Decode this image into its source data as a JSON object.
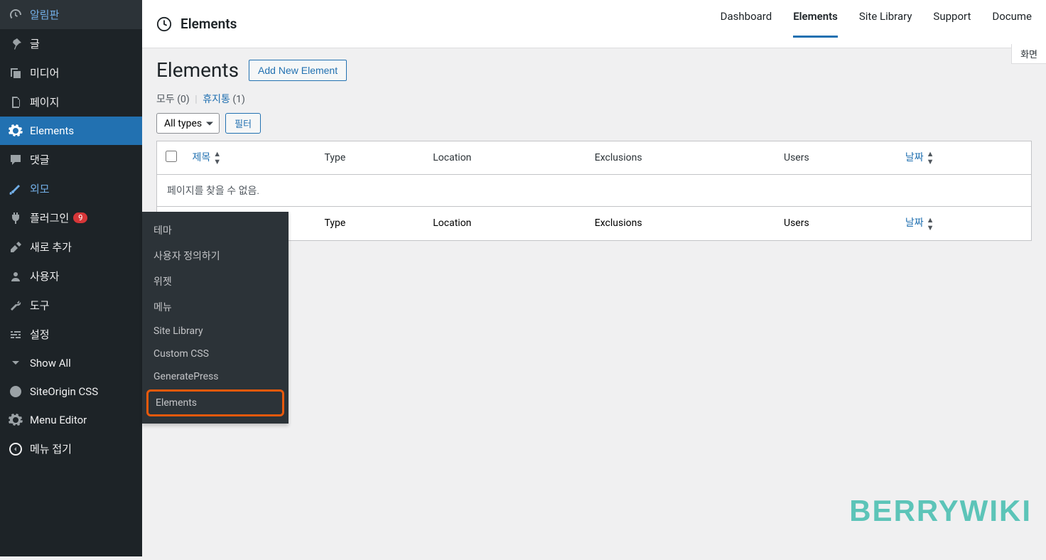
{
  "sidebar": {
    "items": [
      {
        "label": "알림판",
        "icon": "dashboard"
      },
      {
        "label": "글",
        "icon": "pin"
      },
      {
        "label": "미디어",
        "icon": "media"
      },
      {
        "label": "페이지",
        "icon": "page"
      },
      {
        "label": "Elements",
        "icon": "gear",
        "active": true
      },
      {
        "label": "댓글",
        "icon": "comment"
      },
      {
        "label": "외모",
        "icon": "brush",
        "link": true
      },
      {
        "label": "플러그인",
        "icon": "plugin",
        "badge": "9"
      },
      {
        "label": "새로 추가",
        "icon": "tools"
      },
      {
        "label": "사용자",
        "icon": "user"
      },
      {
        "label": "도구",
        "icon": "wrench"
      },
      {
        "label": "설정",
        "icon": "sliders"
      },
      {
        "label": "Show All",
        "icon": "chevron"
      },
      {
        "label": "SiteOrigin CSS",
        "icon": "so"
      },
      {
        "label": "Menu Editor",
        "icon": "gear2"
      },
      {
        "label": "메뉴 접기",
        "icon": "collapse"
      }
    ]
  },
  "submenu": {
    "items": [
      {
        "label": "테마"
      },
      {
        "label": "사용자 정의하기"
      },
      {
        "label": "위젯"
      },
      {
        "label": "메뉴"
      },
      {
        "label": "Site Library"
      },
      {
        "label": "Custom CSS"
      },
      {
        "label": "GeneratePress"
      },
      {
        "label": "Elements",
        "highlighted": true
      }
    ]
  },
  "topbar": {
    "title": "Elements",
    "nav": [
      {
        "label": "Dashboard"
      },
      {
        "label": "Elements",
        "active": true
      },
      {
        "label": "Site Library"
      },
      {
        "label": "Support"
      },
      {
        "label": "Docume"
      }
    ]
  },
  "page": {
    "heading": "Elements",
    "add_button": "Add New Element",
    "screen_options": "화면"
  },
  "subsub": {
    "all_label": "모두",
    "all_count": "(0)",
    "trash_label": "휴지통",
    "trash_count": "(1)"
  },
  "filters": {
    "types_label": "All types",
    "filter_button": "필터"
  },
  "table": {
    "columns": {
      "title": "제목",
      "type": "Type",
      "location": "Location",
      "exclusions": "Exclusions",
      "users": "Users",
      "date": "날짜"
    },
    "empty_message": "페이지를 찾을 수 없음."
  },
  "watermark": "BERRYWIKI"
}
